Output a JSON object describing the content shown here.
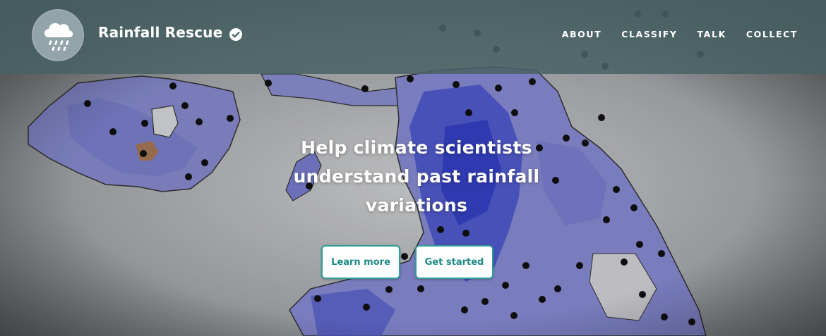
{
  "header": {
    "title": "Rainfall Rescue",
    "logo_icon": "rain-cloud-icon",
    "verified_icon": "verified-check-icon",
    "nav": [
      {
        "label": "ABOUT"
      },
      {
        "label": "CLASSIFY"
      },
      {
        "label": "TALK"
      },
      {
        "label": "COLLECT"
      }
    ]
  },
  "hero": {
    "background_image": "rainfall-map-of-northern-england-and-ireland",
    "headline": "Help climate scientists understand past rainfall variations",
    "buttons": {
      "learn_more": "Learn more",
      "get_started": "Get started"
    }
  },
  "colors": {
    "header_bg": "#486264",
    "accent": "#2f9e98",
    "map_rain_light": "#8a8fd6",
    "map_rain_heavy": "#3340c8"
  }
}
